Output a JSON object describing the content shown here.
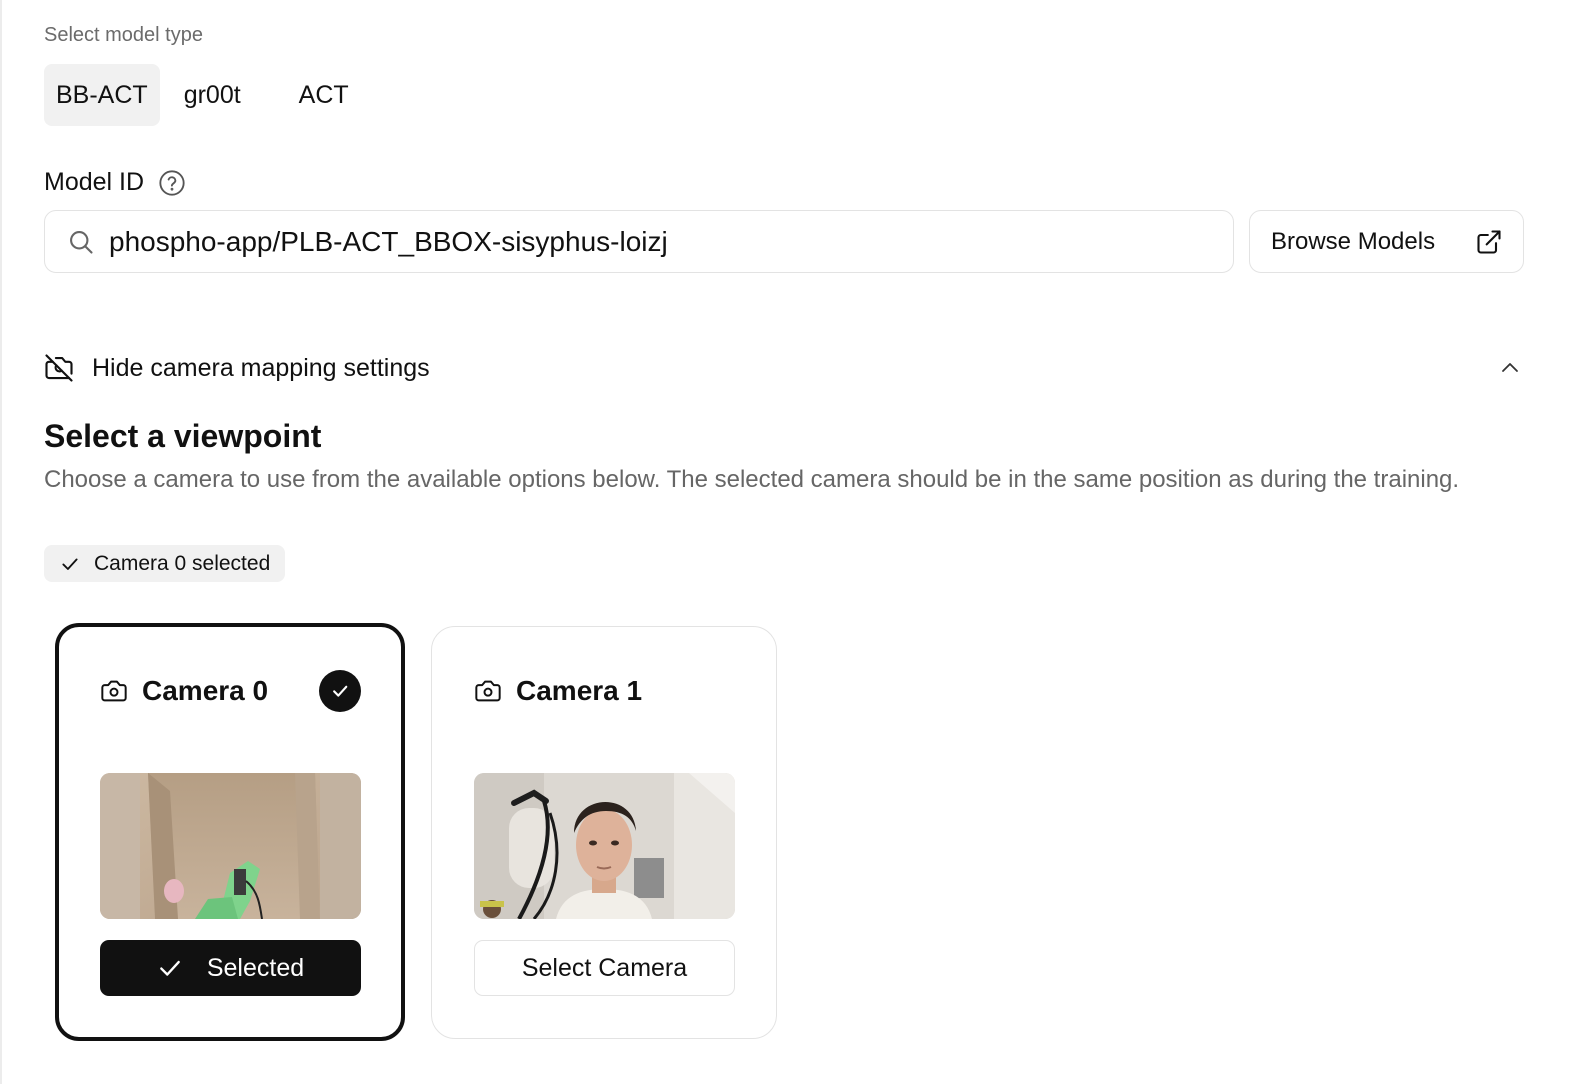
{
  "model_type": {
    "label": "Select model type",
    "options": [
      "BB-ACT",
      "gr00t",
      "ACT"
    ],
    "selected": "BB-ACT"
  },
  "model_id": {
    "label": "Model ID",
    "value": "phospho-app/PLB-ACT_BBOX-sisyphus-loizj",
    "browse_label": "Browse Models"
  },
  "camera_mapping": {
    "toggle_label": "Hide camera mapping settings",
    "expanded": true
  },
  "viewpoint": {
    "title": "Select a viewpoint",
    "description": "Choose a camera to use from the available options below. The selected camera should be in the same position as during the training.",
    "selected_badge": "Camera 0 selected"
  },
  "cameras": [
    {
      "name": "Camera 0",
      "selected": true,
      "button_label": "Selected"
    },
    {
      "name": "Camera 1",
      "selected": false,
      "button_label": "Select Camera"
    }
  ],
  "colors": {
    "primary": "#111111",
    "muted_text": "#6b6b6b",
    "border": "#e3e3e3",
    "chip_bg": "#f1f1f1"
  }
}
